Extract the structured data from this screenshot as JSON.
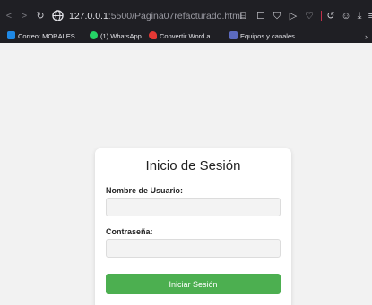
{
  "browser": {
    "url_host": "127.0.0.1",
    "url_path": ":5500/Pagina07refacturado.html",
    "bookmarks": [
      {
        "label": "Correo: MORALES...",
        "color": "#1e88e5"
      },
      {
        "label": "(1) WhatsApp",
        "color": "#25d366"
      },
      {
        "label": "Convertir Word a...",
        "color": "#e53935"
      },
      {
        "label": "Equipos y canales...",
        "color": "#5c6bc0"
      }
    ]
  },
  "login": {
    "title": "Inicio de Sesión",
    "username_label": "Nombre de Usuario:",
    "username_value": "",
    "password_label": "Contraseña:",
    "password_value": "",
    "submit_label": "Iniciar Sesión",
    "submit_color": "#4caf50"
  }
}
